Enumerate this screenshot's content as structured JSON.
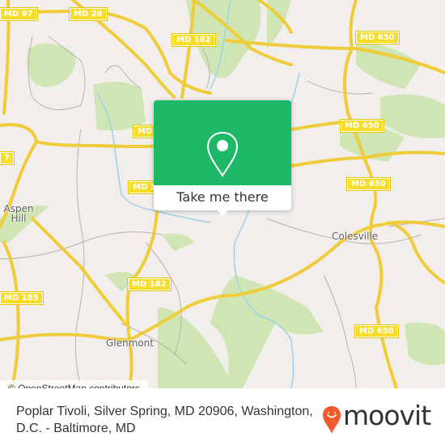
{
  "map": {
    "road_shields": [
      {
        "label": "MD 97",
        "id": "md97-top"
      },
      {
        "label": "MD 28",
        "id": "md28"
      },
      {
        "label": "MD 182",
        "id": "md182-top"
      },
      {
        "label": "MD 650",
        "id": "md650-top"
      },
      {
        "label": "MD",
        "id": "md-partial-1"
      },
      {
        "label": "MD 650",
        "id": "md650-mid"
      },
      {
        "label": "MD 1",
        "id": "md-partial-2"
      },
      {
        "label": "MD 650",
        "id": "md650-lower"
      },
      {
        "label": "MD 182",
        "id": "md182-low"
      },
      {
        "label": "MD 185",
        "id": "md185"
      },
      {
        "label": "MD 650",
        "id": "md650-bottom"
      },
      {
        "label": "7",
        "id": "md97-left"
      }
    ],
    "places": [
      {
        "label": "Aspen\nHill",
        "id": "aspen-hill"
      },
      {
        "label": "Colesville",
        "id": "colesville"
      },
      {
        "label": "Glenmont",
        "id": "glenmont"
      }
    ],
    "colors": {
      "land": "#f1eeeb",
      "park": "#cfe6b4",
      "road_major": "#f7dc5a",
      "water": "#9fd2ea"
    },
    "attribution": "© OpenStreetMap contributors"
  },
  "popup": {
    "icon": "location-pin-icon",
    "button_label": "Take me there",
    "accent_color": "#1db868"
  },
  "footer": {
    "address": "Poplar Tivoli, Silver Spring, MD 20906, Washington, D.C. - Baltimore, MD",
    "brand": "moovit",
    "brand_color": "#f15a2b"
  }
}
